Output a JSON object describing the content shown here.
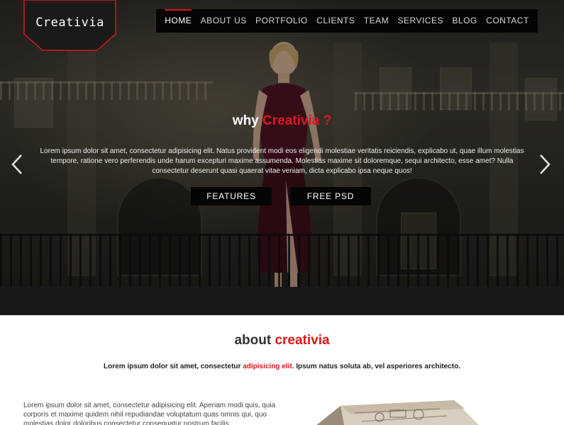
{
  "brand": {
    "logo_text": "Creativia",
    "accent_color": "#d9151c"
  },
  "nav": {
    "items": [
      {
        "label": "HOME",
        "active": true
      },
      {
        "label": "ABOUT US"
      },
      {
        "label": "PORTFOLIO"
      },
      {
        "label": "CLIENTS"
      },
      {
        "label": "TEAM"
      },
      {
        "label": "SERVICES"
      },
      {
        "label": "BLOG"
      },
      {
        "label": "CONTACT"
      }
    ]
  },
  "hero": {
    "title_prefix": "why",
    "title_accent": "Creativia ?",
    "text": "Lorem ipsum dolor sit amet, consectetur adipisicing elit. Natus provident modi eos eligendi molestiae veritatis reiciendis, explicabo ut, quae illum molestias tempore, ratione vero perferendis unde harum excepturi maxime assumenda. Molestias maxime sit doloremque, sequi architecto, esse amet? Nulla consectetur deserunt quasi quaerat vitae veniam, dicta explicabo ipsa neque quos!",
    "buttons": [
      {
        "label": "FEATURES"
      },
      {
        "label": "FREE PSD"
      }
    ],
    "prev_icon": "chevron-left-icon",
    "next_icon": "chevron-right-icon"
  },
  "about": {
    "title_prefix": "about",
    "title_accent": "creativia",
    "subtitle_before": "Lorem ipsum dolor sit amet, consectetur",
    "subtitle_accent": "adipisicing elit.",
    "subtitle_after": "Ipsum natus soluta ab, vel asperiores architecto.",
    "paragraph": "Lorem ipsum dolor sit amet, consectetur adipisicing elit. Aperiam modi quis, quia corporis et maxime quidem nihil repudiandae voluptatum quas omnis qui, quo molestias dolor doloribus consectetur consequatur nostrum facilis."
  }
}
